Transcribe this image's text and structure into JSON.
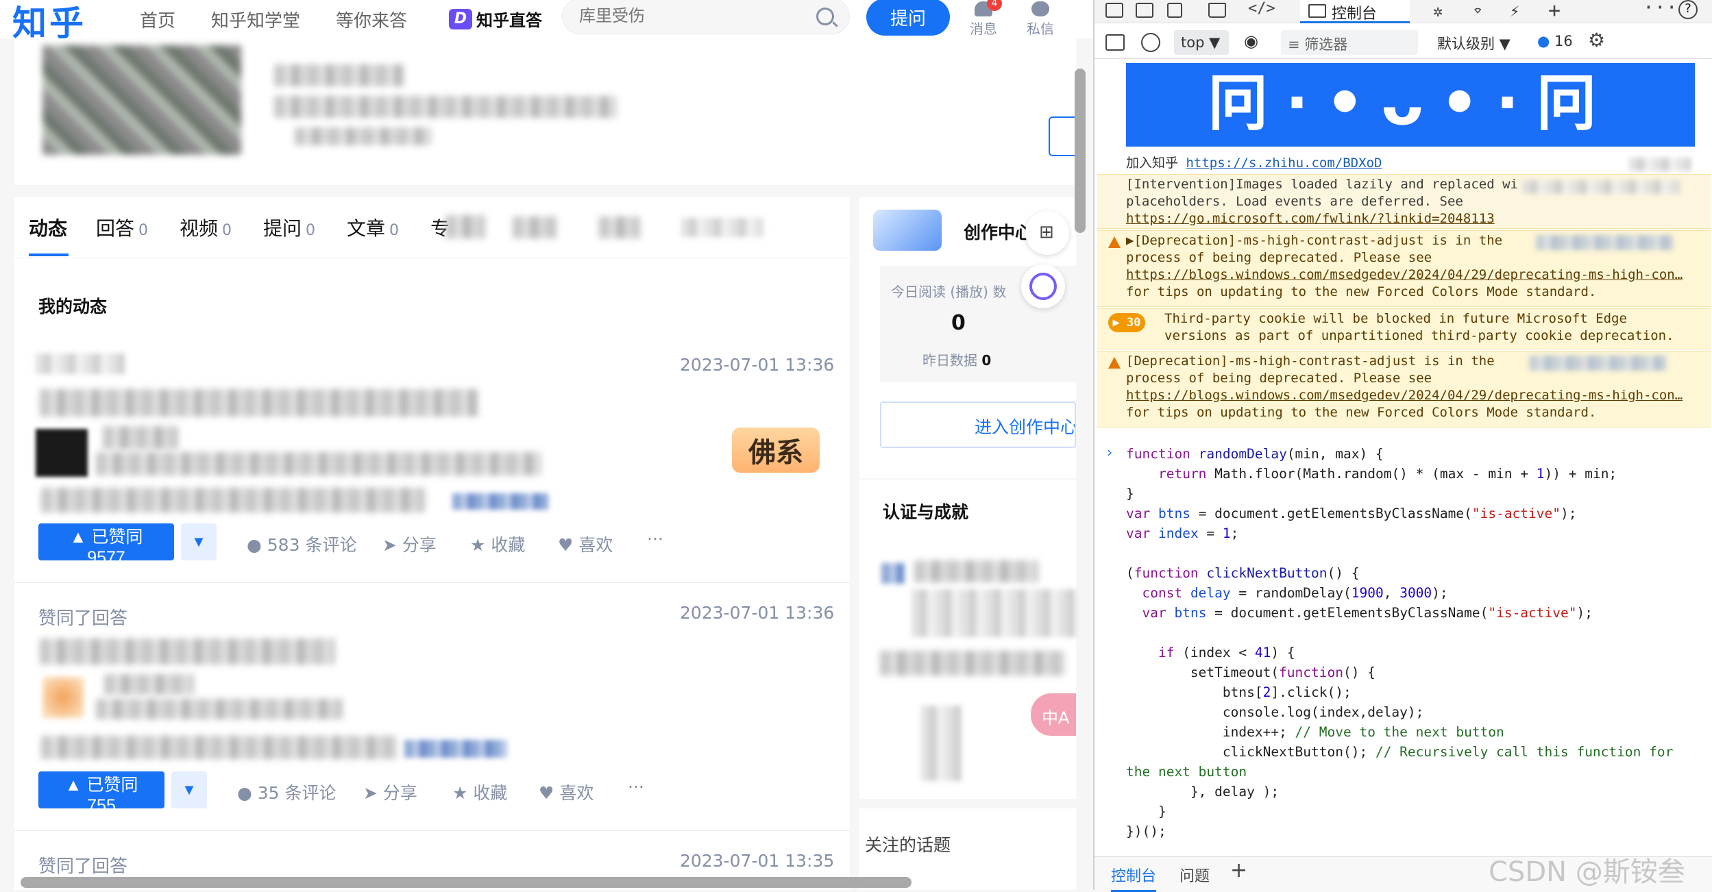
{
  "topbar": {
    "logo": "知乎",
    "nav": [
      "首页",
      "知乎知学堂",
      "等你来答"
    ],
    "zhida_icon": "D",
    "zhida_label": "知乎直答",
    "search_placeholder": "库里受伤",
    "ask_label": "提问",
    "messages_label": "消息",
    "messages_badge": "4",
    "dm_label": "私信"
  },
  "profile_tabs": [
    {
      "label": "动态",
      "count": ""
    },
    {
      "label": "回答",
      "count": "0"
    },
    {
      "label": "视频",
      "count": "0"
    },
    {
      "label": "提问",
      "count": "0"
    },
    {
      "label": "文章",
      "count": "0"
    },
    {
      "label": "专",
      "count": ""
    }
  ],
  "feed": {
    "section_title": "我的动态",
    "items": [
      {
        "label": "",
        "time": "2023-07-01 13:36",
        "vote_label": "▲ 已赞同 9577",
        "comments": "583 条评论"
      },
      {
        "label": "赞同了回答",
        "time": "2023-07-01 13:36",
        "vote_label": "▲ 已赞同 755",
        "comments": "35 条评论"
      },
      {
        "label": "赞同了回答",
        "time": "2023-07-01 13:35"
      }
    ],
    "share_label": "分享",
    "collect_label": "收藏",
    "like_label": "喜欢",
    "more_label": "···",
    "sticker_text": "佛系"
  },
  "sidebar": {
    "creator_title": "创作中心",
    "today_reads_label": "今日阅读 (播放) 数",
    "today_reads_value": "0",
    "yesterday_label": "昨日数据",
    "yesterday_value": "0",
    "enter_creator": "进入创作中心",
    "cert_title": "认证与成就",
    "topics_title": "关注的话题",
    "translate_label": "中A"
  },
  "devtools": {
    "active_tab": "控制台",
    "context": "top",
    "filter_placeholder": "筛选器",
    "level": "默认级别",
    "issue_count": "16",
    "join_text": "加入知乎",
    "join_link": "https://s.zhihu.com/BDXoD",
    "banner_text": "冋·•ᴗ•·冋",
    "intervention": {
      "text": "[Intervention]Images loaded lazily and replaced wi\nplaceholders. Load events are deferred. See",
      "link": "https://go.microsoft.com/fwlink/?linkid=2048113"
    },
    "deprecation1": {
      "text": "▶[Deprecation]-ms-high-contrast-adjust is in the\nprocess of being deprecated. Please see",
      "link": "https://blogs.windows.com/msedgedev/2024/04/29/deprecating-ms-high-con…",
      "tail": "for tips on updating to the new Forced Colors Mode standard."
    },
    "cookie": {
      "count": "30",
      "text": "Third-party cookie will be blocked in future Microsoft Edge\nversions as part of unpartitioned third-party cookie deprecation."
    },
    "deprecation2": {
      "text": "[Deprecation]-ms-high-contrast-adjust is in the\nprocess of being deprecated. Please see",
      "link": "https://blogs.windows.com/msedgedev/2024/04/29/deprecating-ms-high-con…",
      "tail": "for tips on updating to the new Forced Colors Mode standard."
    },
    "bottom_tabs": [
      "控制台",
      "问题"
    ],
    "watermark": "CSDN @斯铵叁"
  },
  "colors": {
    "brand": "#1772f6",
    "warn_bg": "#fef6d5",
    "warn_icon": "#e37400"
  }
}
